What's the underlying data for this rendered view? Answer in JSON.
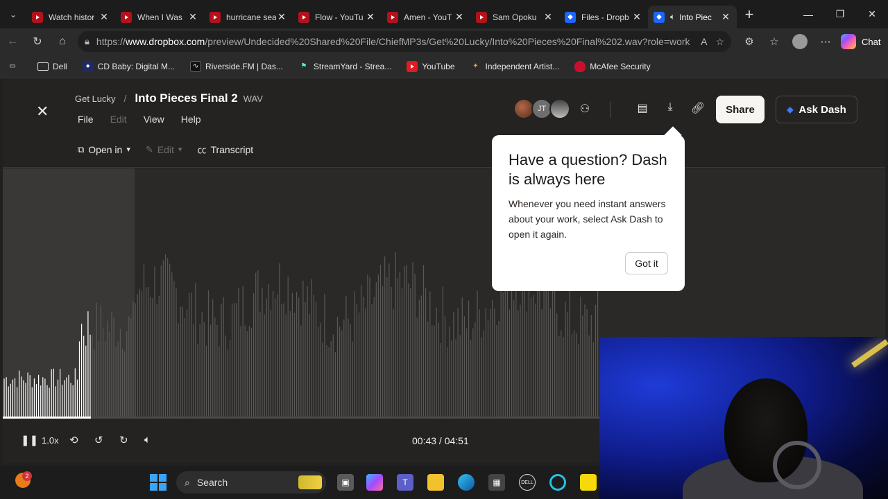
{
  "browser": {
    "tabs": [
      {
        "title": "Watch histor",
        "icon": "youtube-icon",
        "active": false
      },
      {
        "title": "When I Was",
        "icon": "youtube-icon",
        "active": false
      },
      {
        "title": "hurricane sea",
        "icon": "youtube-icon",
        "active": false
      },
      {
        "title": "Flow - YouTu",
        "icon": "youtube-icon",
        "active": false
      },
      {
        "title": "Amen - YouT",
        "icon": "youtube-icon",
        "active": false
      },
      {
        "title": "Sam Opoku",
        "icon": "youtube-icon",
        "active": false
      },
      {
        "title": "Files - Dropb",
        "icon": "dropbox-icon",
        "active": false
      },
      {
        "title": "Into Piec",
        "icon": "dropbox-icon",
        "active": true
      }
    ],
    "url_prefix": "https://",
    "url_domain": "www.dropbox.com",
    "url_path": "/preview/Undecided%20Shared%20File/ChiefMP3s/Get%20Lucky/Into%20Pieces%20Final%202.wav?role=work",
    "chat_label": "Chat",
    "bookmarks": [
      "Dell",
      "CD Baby: Digital M...",
      "Riverside.FM | Das...",
      "StreamYard - Strea...",
      "YouTube",
      "Independent Artist...",
      "McAfee Security"
    ]
  },
  "file": {
    "parent_folder": "Get Lucky",
    "name": "Into Pieces Final 2",
    "type": "WAV",
    "menus": [
      "File",
      "Edit",
      "View",
      "Help"
    ],
    "toolbar": {
      "open_in": "Open in",
      "edit": "Edit",
      "transcript": "Transcript"
    },
    "avatar_initials": "JT",
    "share_label": "Share",
    "ask_dash_label": "Ask Dash"
  },
  "popover": {
    "title": "Have a question? Dash is always here",
    "body": "Whenever you need instant answers about your work, select Ask Dash to open it again.",
    "button": "Got it"
  },
  "player": {
    "speed": "1.0x",
    "time": "00:43 / 04:51",
    "progress": 0.148
  },
  "taskbar": {
    "search_placeholder": "Search",
    "notification_count": "2"
  },
  "colors": {
    "page_bg": "#242322",
    "wave_played": "#ffffff",
    "wave_unplayed": "#5a5856",
    "accent": "#3d7cff"
  }
}
